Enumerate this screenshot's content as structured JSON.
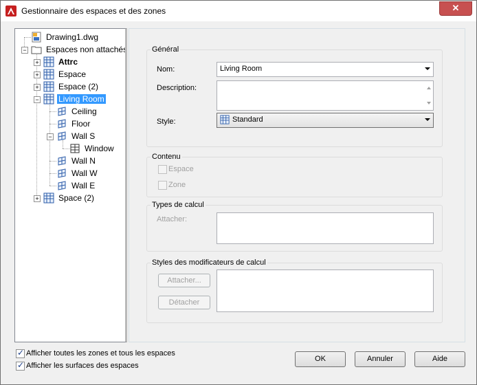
{
  "window": {
    "title": "Gestionnaire des espaces et des zones",
    "close_label": "✕"
  },
  "tree": {
    "nodes": [
      {
        "label": "Drawing1.dwg",
        "icon": "dwg-file-icon"
      },
      {
        "label": "Espaces non attachés",
        "icon": "folder-icon"
      },
      {
        "label": "Attrc",
        "icon": "space-grid-icon"
      },
      {
        "label": "Espace",
        "icon": "space-grid-icon"
      },
      {
        "label": "Espace (2)",
        "icon": "space-grid-icon"
      },
      {
        "label": "Living Room",
        "icon": "space-grid-icon"
      },
      {
        "label": "Ceiling",
        "icon": "surface-icon"
      },
      {
        "label": "Floor",
        "icon": "surface-icon"
      },
      {
        "label": "Wall S",
        "icon": "surface-icon"
      },
      {
        "label": "Window",
        "icon": "opening-icon"
      },
      {
        "label": "Wall N",
        "icon": "surface-icon"
      },
      {
        "label": "Wall W",
        "icon": "surface-icon"
      },
      {
        "label": "Wall E",
        "icon": "surface-icon"
      },
      {
        "label": "Space (2)",
        "icon": "space-grid-icon"
      }
    ]
  },
  "general": {
    "title": "Général",
    "name_label": "Nom:",
    "name_value": "Living Room",
    "description_label": "Description:",
    "description_value": "",
    "style_label": "Style:",
    "style_value": "Standard"
  },
  "contents": {
    "title": "Contenu",
    "space_label": "Espace",
    "zone_label": "Zone"
  },
  "calc_types": {
    "title": "Types de calcul",
    "attach_label": "Attacher:"
  },
  "calc_styles": {
    "title": "Styles des modificateurs de calcul",
    "attach_button": "Attacher...",
    "detach_button": "Détacher"
  },
  "options": {
    "show_all_label": "Afficher toutes les zones et tous les espaces",
    "show_surfaces_label": "Afficher les surfaces des espaces"
  },
  "buttons": {
    "ok": "OK",
    "cancel": "Annuler",
    "help": "Aide"
  },
  "colors": {
    "selection": "#3399ff",
    "close": "#c75050"
  }
}
